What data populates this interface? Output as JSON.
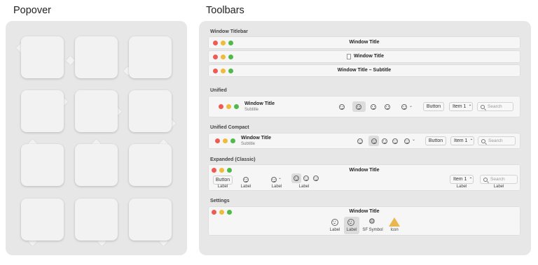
{
  "popover": {
    "heading": "Popover"
  },
  "toolbars": {
    "heading": "Toolbars",
    "window_titlebar": {
      "section": "Window Titlebar",
      "titles": [
        "Window Title",
        "Window Title",
        "Window Title – Subtitle"
      ]
    },
    "unified": {
      "section": "Unified",
      "title": "Window Title",
      "subtitle": "Subtitle",
      "button": "Button",
      "item": "Item 1",
      "search_placeholder": "Search"
    },
    "unified_compact": {
      "section": "Unified Compact",
      "title": "Window Title",
      "subtitle": "Subtitle",
      "button": "Button",
      "item": "Item 1",
      "search_placeholder": "Search"
    },
    "expanded": {
      "section": "Expanded (Classic)",
      "title": "Window Title",
      "button": "Button",
      "item": "Item 1",
      "search_placeholder": "Search",
      "label": "Label"
    },
    "settings": {
      "section": "Settings",
      "title": "Window Title",
      "tabs": [
        "Label",
        "Label",
        "SF Symbol",
        "Icon"
      ]
    }
  },
  "colors": {
    "close": "#ee5b53",
    "minimize": "#efbb3a",
    "zoom": "#4fba4a",
    "panel": "#e7e7e7"
  }
}
